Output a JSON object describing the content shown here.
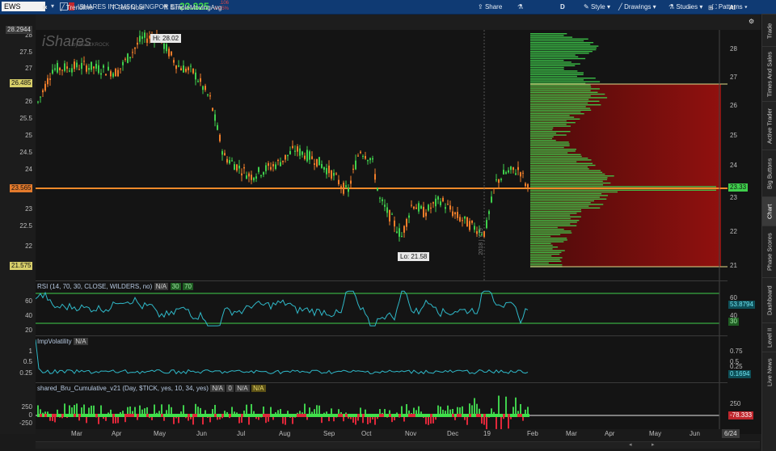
{
  "header": {
    "symbol": "EWS",
    "company": "ISHARES INC MSCI SINGPOR ETF",
    "last": "23.325",
    "change": ".106",
    "change_pct": "-0.45%",
    "share_label": "Share",
    "d_label": "D",
    "style_label": "Style",
    "drawings_label": "Drawings",
    "studies_label": "Studies",
    "patterns_label": "Patterns"
  },
  "tools": {
    "trendline": "Trendline",
    "textnote": "Text Note",
    "sma": "SimpleMovingAvg"
  },
  "price_chart": {
    "watermark": "iShares",
    "watermark_sub": "by BLACKROCK",
    "hi_label": "Hi: 28.02",
    "lo_label": "Lo: 21.58",
    "year_label": "2018 | Y19",
    "left_ticks": [
      "28",
      "27.5",
      "27",
      "26.5",
      "26",
      "25.5",
      "25",
      "24.5",
      "24",
      "23.5",
      "23",
      "22.5",
      "22",
      "21.5"
    ],
    "right_ticks": [
      "28",
      "27",
      "26",
      "25",
      "24",
      "23",
      "22",
      "21"
    ],
    "left_marker_top": "28.2944",
    "left_marker_high": "26.485",
    "left_marker_last": "23.565",
    "left_marker_low": "21.575",
    "right_marker_last": "23.33"
  },
  "rsi": {
    "title": "RSI (14, 70, 30, CLOSE, WILDERS, no)",
    "na": "N/A",
    "ob": "30",
    "os": "70",
    "ticks": [
      "60",
      "40",
      "20"
    ],
    "right_ticks": [
      "60",
      "40"
    ],
    "value": "53.8794",
    "level": "30"
  },
  "impvol": {
    "title": "ImpVolatility",
    "na": "N/A",
    "ticks": [
      "1",
      "0.5",
      "0.25"
    ],
    "right_ticks": [
      "0.75",
      "0.5",
      "0.25"
    ],
    "value": "0.1694"
  },
  "bru": {
    "title": "shared_Bru_Cumulative_v21 (Day, $TICK, yes, 10, 34, yes)",
    "na1": "N/A",
    "zero": "0",
    "na2": "N/A",
    "na3": "N/A",
    "ticks": [
      "250",
      "0",
      "-250"
    ],
    "right_ticks": [
      "250",
      "0"
    ],
    "value": "-78.333"
  },
  "months": [
    "Mar",
    "Apr",
    "May",
    "Jun",
    "Jul",
    "Aug",
    "Sep",
    "Oct",
    "Nov",
    "Dec",
    "19",
    "Feb",
    "Mar",
    "Apr",
    "May",
    "Jun"
  ],
  "bottom_right": "6/24",
  "right_tabs": [
    "Trade",
    "Times And Sales",
    "Active Trader",
    "Big Buttons",
    "Chart",
    "Phase Scores",
    "Dashboard",
    "Level II",
    "Live News"
  ],
  "colors": {
    "up": "#3fcf4c",
    "down": "#ef7d2a",
    "rsi": "#2fb9c9",
    "accent": "#0f3a73"
  }
}
